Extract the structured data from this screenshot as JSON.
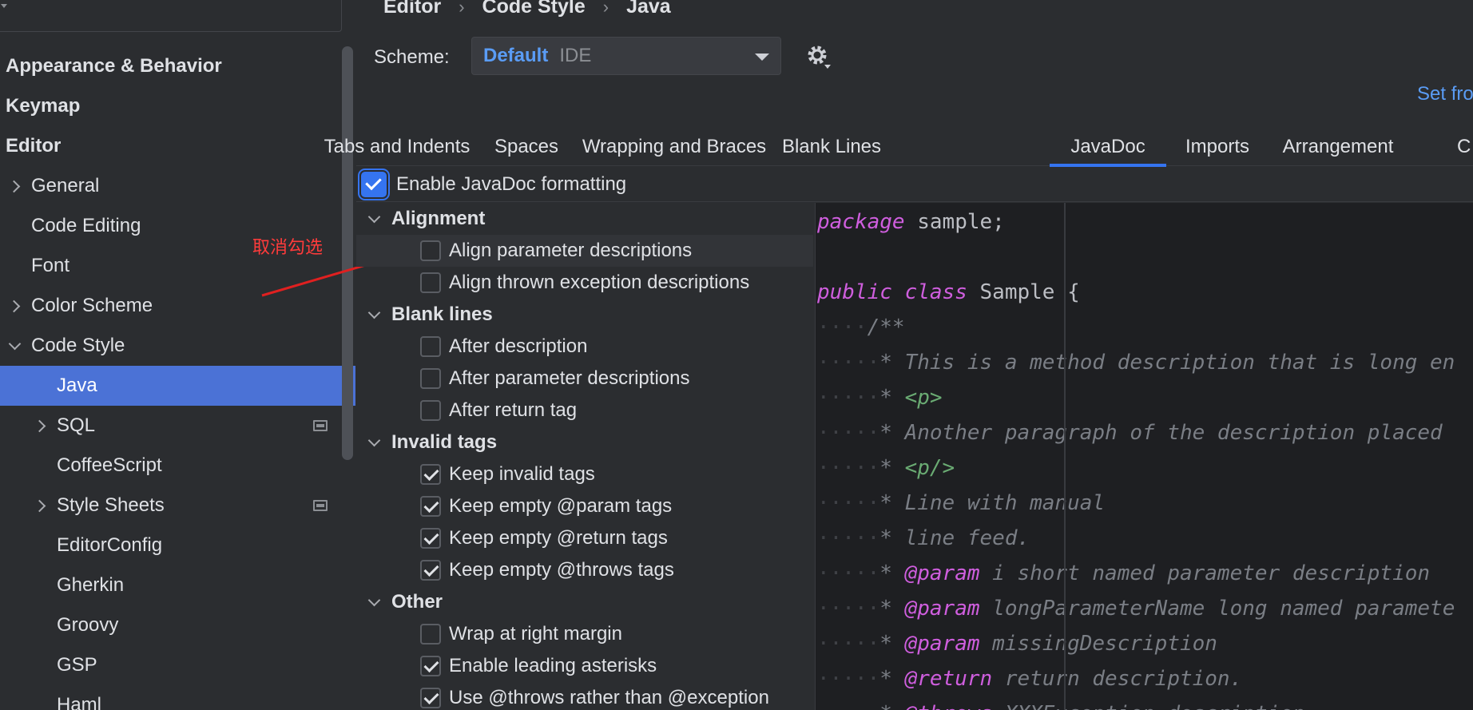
{
  "sidebar": {
    "items": [
      {
        "label": "Appearance & Behavior",
        "bold": true
      },
      {
        "label": "Keymap",
        "bold": true
      },
      {
        "label": "Editor",
        "bold": true
      },
      {
        "label": "General"
      },
      {
        "label": "Code Editing"
      },
      {
        "label": "Font"
      },
      {
        "label": "Color Scheme"
      },
      {
        "label": "Code Style"
      },
      {
        "label": "Java",
        "selected": true
      },
      {
        "label": "SQL"
      },
      {
        "label": "CoffeeScript"
      },
      {
        "label": "Style Sheets"
      },
      {
        "label": "EditorConfig"
      },
      {
        "label": "Gherkin"
      },
      {
        "label": "Groovy"
      },
      {
        "label": "GSP"
      },
      {
        "label": "Haml"
      }
    ]
  },
  "annotation": {
    "text": "取消勾选",
    "color": "#ff3b3b"
  },
  "breadcrumb": [
    "Editor",
    "Code Style",
    "Java"
  ],
  "scheme": {
    "label": "Scheme:",
    "name": "Default",
    "sub": "IDE"
  },
  "set_from": "Set fro",
  "tabs": [
    "Tabs and Indents",
    "Spaces",
    "Wrapping and Braces",
    "Blank Lines",
    "JavaDoc",
    "Imports",
    "Arrangement",
    "C"
  ],
  "active_tab": "JavaDoc",
  "enable_javadoc": {
    "label": "Enable JavaDoc formatting",
    "checked": true
  },
  "sections": {
    "alignment": {
      "title": "Alignment",
      "options": [
        {
          "label": "Align parameter descriptions",
          "checked": false
        },
        {
          "label": "Align thrown exception descriptions",
          "checked": false
        }
      ]
    },
    "blank_lines": {
      "title": "Blank lines",
      "options": [
        {
          "label": "After description",
          "checked": false
        },
        {
          "label": "After parameter descriptions",
          "checked": false
        },
        {
          "label": "After return tag",
          "checked": false
        }
      ]
    },
    "invalid_tags": {
      "title": "Invalid tags",
      "options": [
        {
          "label": "Keep invalid tags",
          "checked": true
        },
        {
          "label": "Keep empty @param tags",
          "checked": true
        },
        {
          "label": "Keep empty @return tags",
          "checked": true
        },
        {
          "label": "Keep empty @throws tags",
          "checked": true
        }
      ]
    },
    "other": {
      "title": "Other",
      "options": [
        {
          "label": "Wrap at right margin",
          "checked": false
        },
        {
          "label": "Enable leading asterisks",
          "checked": true
        },
        {
          "label": "Use @throws rather than @exception",
          "checked": true
        }
      ]
    }
  },
  "code": {
    "line1_kw": "package",
    "line1_rest": " sample;",
    "line3_kw1": "public",
    "line3_kw2": "class",
    "line3_rest": " Sample {",
    "c_open": "/**",
    "c1": "* This is a method description that is long en",
    "c2_star": "* ",
    "c2_tag": "<p>",
    "c3": "* Another paragraph of the description placed ",
    "c4_star": "* ",
    "c4_tag": "<p/>",
    "c5": "* Line with manual",
    "c6": "* line feed.",
    "c7_tag": "@param",
    "c7_rest": " i short named parameter description",
    "c8_tag": "@param",
    "c8_rest": " longParameterName long named paramete",
    "c9_tag": "@param",
    "c9_rest": " missingDescription",
    "c10_tag": "@return",
    "c10_rest": " return description.",
    "c11_tag": "@throws",
    "c11_rest": " XXXException description."
  }
}
